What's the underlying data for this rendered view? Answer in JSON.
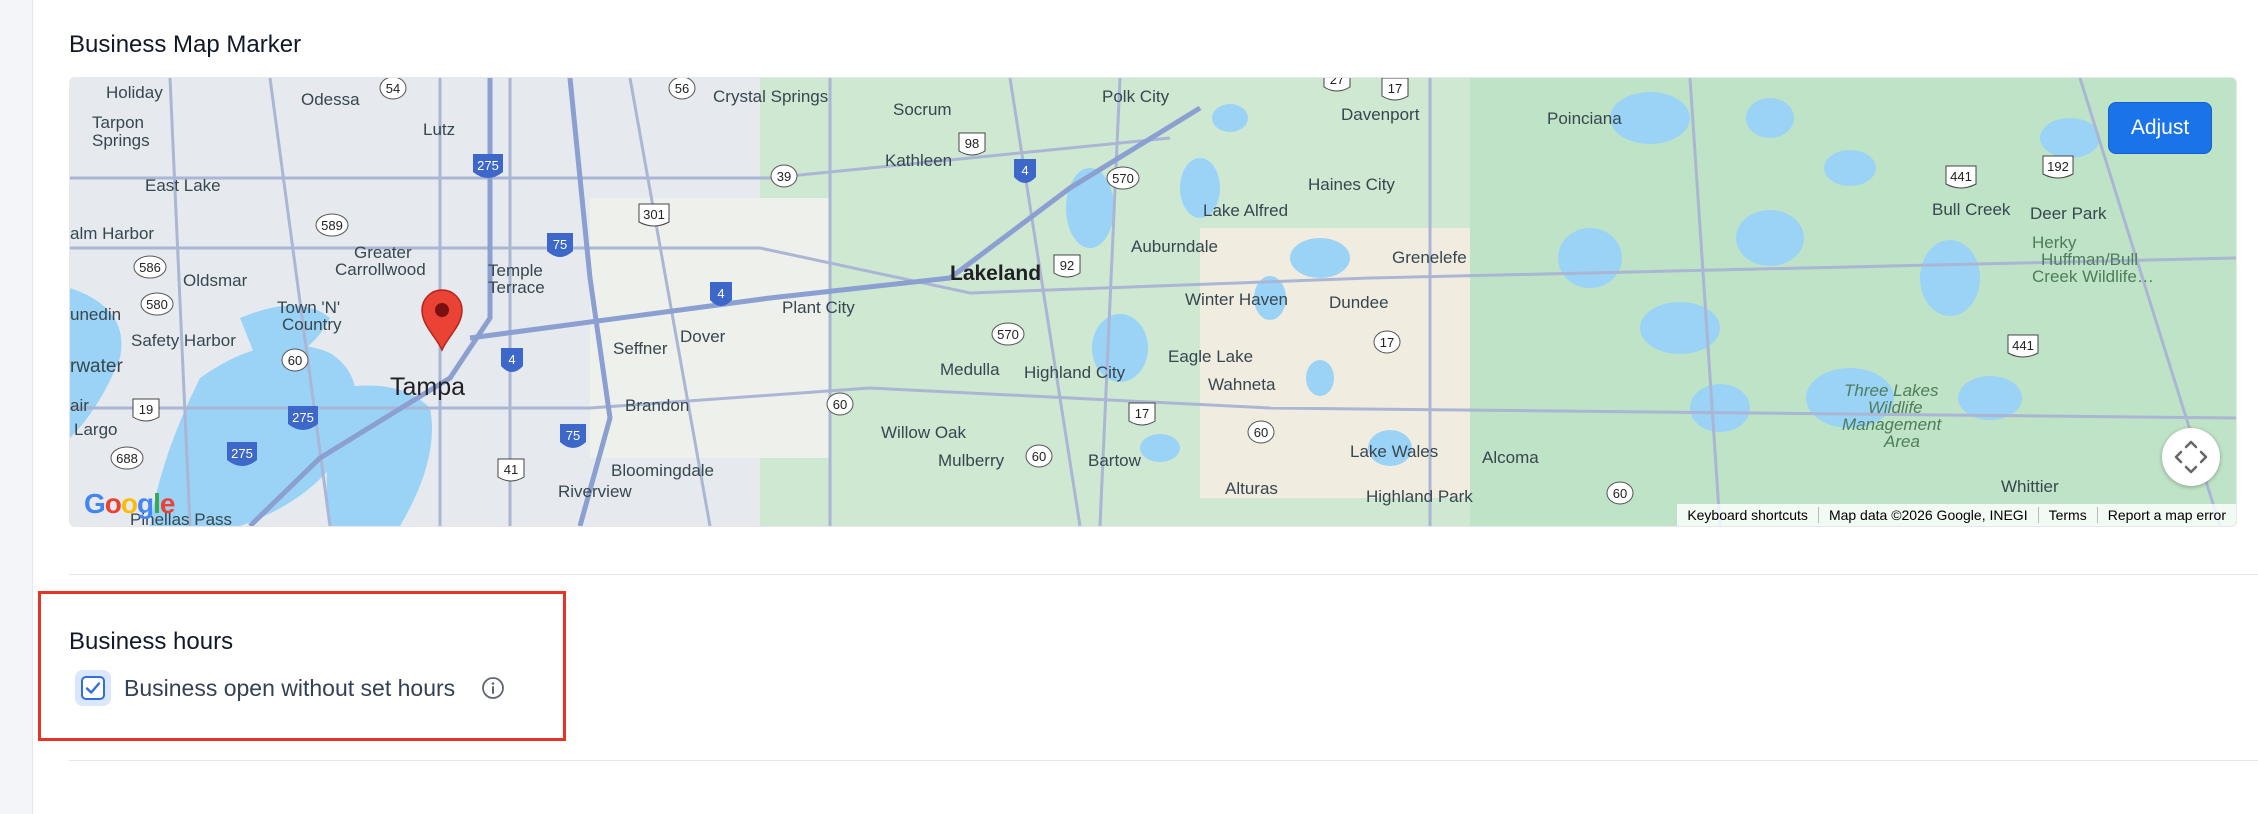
{
  "map_section": {
    "title": "Business Map Marker",
    "adjust_label": "Adjust",
    "attribution": {
      "keyboard_shortcuts": "Keyboard shortcuts",
      "map_data": "Map data ©2026 Google, INEGI",
      "terms": "Terms",
      "report": "Report a map error"
    },
    "logo_text": "Google",
    "places": {
      "tampa": "Tampa",
      "lakeland": "Lakeland",
      "holiday": "Holiday",
      "odessa": "Odessa",
      "crystal_springs": "Crystal Springs",
      "socrum": "Socrum",
      "polk_city": "Polk City",
      "davenport": "Davenport",
      "poinciana": "Poinciana",
      "tarpon_springs": "Tarpon\nSprings",
      "lutz": "Lutz",
      "kathleen": "Kathleen",
      "haines_city": "Haines City",
      "east_lake": "East Lake",
      "lake_alfred": "Lake Alfred",
      "bull_creek": "Bull Creek",
      "deer_park": "Deer Park",
      "palm_harbor": "alm Harbor",
      "greater_carrollwood": "Greater\nCarrollwood",
      "temple_terrace": "Temple\nTerrace",
      "auburndale": "Auburndale",
      "grenelefe": "Grenelefe",
      "herky": "Herky\nHuffman/Bull\nCreek Wildlife…",
      "oldsmar": "Oldsmar",
      "dunedin": "unedin",
      "town_n_country": "Town 'N'\nCountry",
      "plant_city": "Plant City",
      "winter_haven": "Winter Haven",
      "dundee": "Dundee",
      "safety_harbor": "Safety Harbor",
      "seffner": "Seffner",
      "dover": "Dover",
      "eagle_lake": "Eagle Lake",
      "clearwater": "rwater",
      "medulla": "Medulla",
      "highland_city": "Highland City",
      "wahneta": "Wahneta",
      "three_lakes": "Three Lakes\nWildlife\nManagement\nArea",
      "brandon": "Brandon",
      "belleair": "air",
      "largo": "Largo",
      "willow_oak": "Willow Oak",
      "bloomingdale": "Bloomingdale",
      "mulberry": "Mulberry",
      "bartow": "Bartow",
      "lake_wales": "Lake Wales",
      "alcoma": "Alcoma",
      "alturas": "Alturas",
      "whittier": "Whittier",
      "riverview": "Riverview",
      "highland_park": "Highland Park",
      "pinellas_park": "Pinellas Pass"
    },
    "shields": {
      "i275a": "275",
      "i275b": "275",
      "i275c": "275",
      "i75a": "75",
      "i75b": "75",
      "i4a": "4",
      "i4b": "4",
      "i4c": "4",
      "us301": "301",
      "us98": "98",
      "us92": "92",
      "us17": "17",
      "us17b": "17",
      "us41": "41",
      "us441": "441",
      "us441b": "441",
      "us27": "27",
      "us19": "19",
      "us192": "192",
      "sr54": "54",
      "sr56": "56",
      "sr39": "39",
      "sr589": "589",
      "sr586": "586",
      "sr580": "580",
      "sr60a": "60",
      "sr60b": "60",
      "sr60c": "60",
      "sr60d": "60",
      "sr60e": "60",
      "sr570a": "570",
      "sr570b": "570",
      "sr17": "17",
      "sr688": "688"
    }
  },
  "hours_section": {
    "title": "Business hours",
    "checkbox_label": "Business open without set hours",
    "checkbox_checked": true
  },
  "colors": {
    "accent": "#1a73e8",
    "highlight": "#e53425",
    "checkbox_border": "#2f6fde",
    "map_land": "#cfead9",
    "map_water": "#9ad3f5"
  }
}
